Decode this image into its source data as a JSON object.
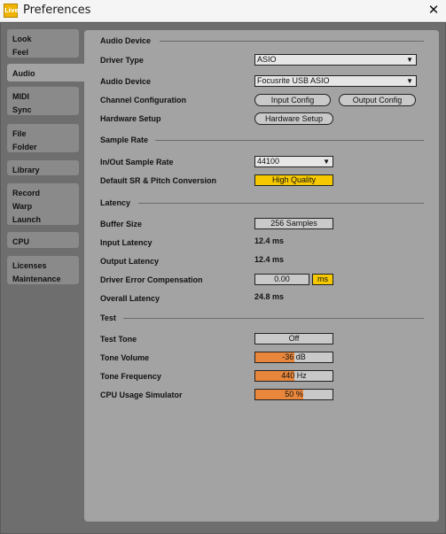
{
  "window": {
    "title": "Preferences",
    "app_icon_text": "Live",
    "close_glyph": "✕"
  },
  "sidebar": {
    "tabs": [
      {
        "line1": "Look",
        "line2": "Feel"
      },
      {
        "line1": "Audio",
        "line2": ""
      },
      {
        "line1": "MIDI",
        "line2": "Sync"
      },
      {
        "line1": "File",
        "line2": "Folder"
      },
      {
        "line1": "Library",
        "line2": ""
      },
      {
        "line1": "Record",
        "line2": "Warp",
        "line3": "Launch"
      },
      {
        "line1": "CPU",
        "line2": ""
      },
      {
        "line1": "Licenses",
        "line2": "Maintenance"
      }
    ],
    "active": "Audio"
  },
  "audio_device": {
    "section_title": "Audio Device",
    "driver_type_label": "Driver Type",
    "driver_type_value": "ASIO",
    "audio_device_label": "Audio Device",
    "audio_device_value": "Focusrite USB ASIO",
    "channel_config_label": "Channel Configuration",
    "input_config_button": "Input Config",
    "output_config_button": "Output Config",
    "hardware_setup_label": "Hardware Setup",
    "hardware_setup_button": "Hardware Setup"
  },
  "sample_rate": {
    "section_title": "Sample Rate",
    "in_out_label": "In/Out Sample Rate",
    "in_out_value": "44100",
    "default_sr_label": "Default SR & Pitch Conversion",
    "default_sr_value": "High Quality"
  },
  "latency": {
    "section_title": "Latency",
    "buffer_size_label": "Buffer Size",
    "buffer_size_value": "256 Samples",
    "input_latency_label": "Input Latency",
    "input_latency_value": "12.4 ms",
    "output_latency_label": "Output Latency",
    "output_latency_value": "12.4 ms",
    "driver_error_label": "Driver Error Compensation",
    "driver_error_value": "0.00",
    "driver_error_unit": "ms",
    "overall_latency_label": "Overall Latency",
    "overall_latency_value": "24.8 ms"
  },
  "test": {
    "section_title": "Test",
    "test_tone_label": "Test Tone",
    "test_tone_value": "Off",
    "tone_volume_label": "Tone Volume",
    "tone_volume_value": "-36 dB",
    "tone_volume_level": 0.5,
    "tone_frequency_label": "Tone Frequency",
    "tone_frequency_value": "440 Hz",
    "tone_frequency_level": 0.5,
    "cpu_sim_label": "CPU Usage Simulator",
    "cpu_sim_value": "50 %",
    "cpu_sim_level": 0.62
  },
  "colors": {
    "panel_bg": "#a3a3a3",
    "window_bg": "#6e6e6e",
    "accent_yellow": "#f5c800",
    "accent_orange": "#e8873c"
  }
}
